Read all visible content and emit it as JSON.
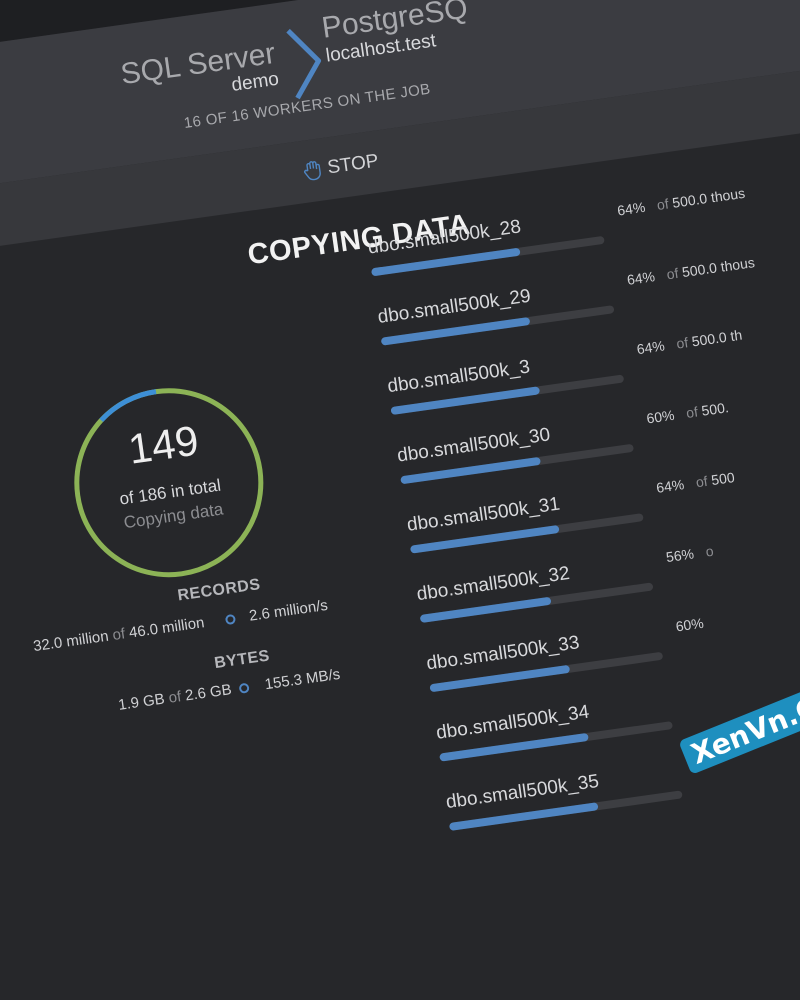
{
  "header": {
    "source": {
      "name": "SQL Server",
      "database": "demo"
    },
    "target": {
      "name": "PostgreSQ",
      "host": "localhost.test"
    },
    "workers_text": "16 OF 16 WORKERS ON THE JOB",
    "stop_label": "STOP"
  },
  "main": {
    "title": "COPYING DATA"
  },
  "progress": {
    "count": "149",
    "total_text": "of 186 in total",
    "status": "Copying data",
    "fraction": 0.801
  },
  "stats": {
    "records": {
      "heading": "RECORDS",
      "done": "32.0 million",
      "of": "of",
      "total": "46.0 million",
      "rate": "2.6 million/s"
    },
    "bytes": {
      "heading": "BYTES",
      "done": "1.9 GB",
      "of": "of",
      "total": "2.6 GB",
      "rate": "155.3 MB/s"
    }
  },
  "tables": [
    {
      "name": "dbo.small500k_28",
      "percent_text": "64%",
      "percent": 64,
      "of": "of",
      "total": "500.0 thous"
    },
    {
      "name": "dbo.small500k_29",
      "percent_text": "64%",
      "percent": 64,
      "of": "of",
      "total": "500.0 thous"
    },
    {
      "name": "dbo.small500k_3",
      "percent_text": "64%",
      "percent": 64,
      "of": "of",
      "total": "500.0 th"
    },
    {
      "name": "dbo.small500k_30",
      "percent_text": "60%",
      "percent": 60,
      "of": "of",
      "total": "500."
    },
    {
      "name": "dbo.small500k_31",
      "percent_text": "64%",
      "percent": 64,
      "of": "of",
      "total": "500"
    },
    {
      "name": "dbo.small500k_32",
      "percent_text": "56%",
      "percent": 56,
      "of": "o",
      "total": ""
    },
    {
      "name": "dbo.small500k_33",
      "percent_text": "60%",
      "percent": 60,
      "of": "",
      "total": ""
    },
    {
      "name": "dbo.small500k_34",
      "percent_text": "",
      "percent": 64,
      "of": "",
      "total": ""
    },
    {
      "name": "dbo.small500k_35",
      "percent_text": "",
      "percent": 64,
      "of": "",
      "total": ""
    }
  ],
  "watermark": {
    "text": "XenVn.Com"
  },
  "colors": {
    "accent": "#4f85c2",
    "ring": "#8cb356",
    "background": "#26272a"
  }
}
